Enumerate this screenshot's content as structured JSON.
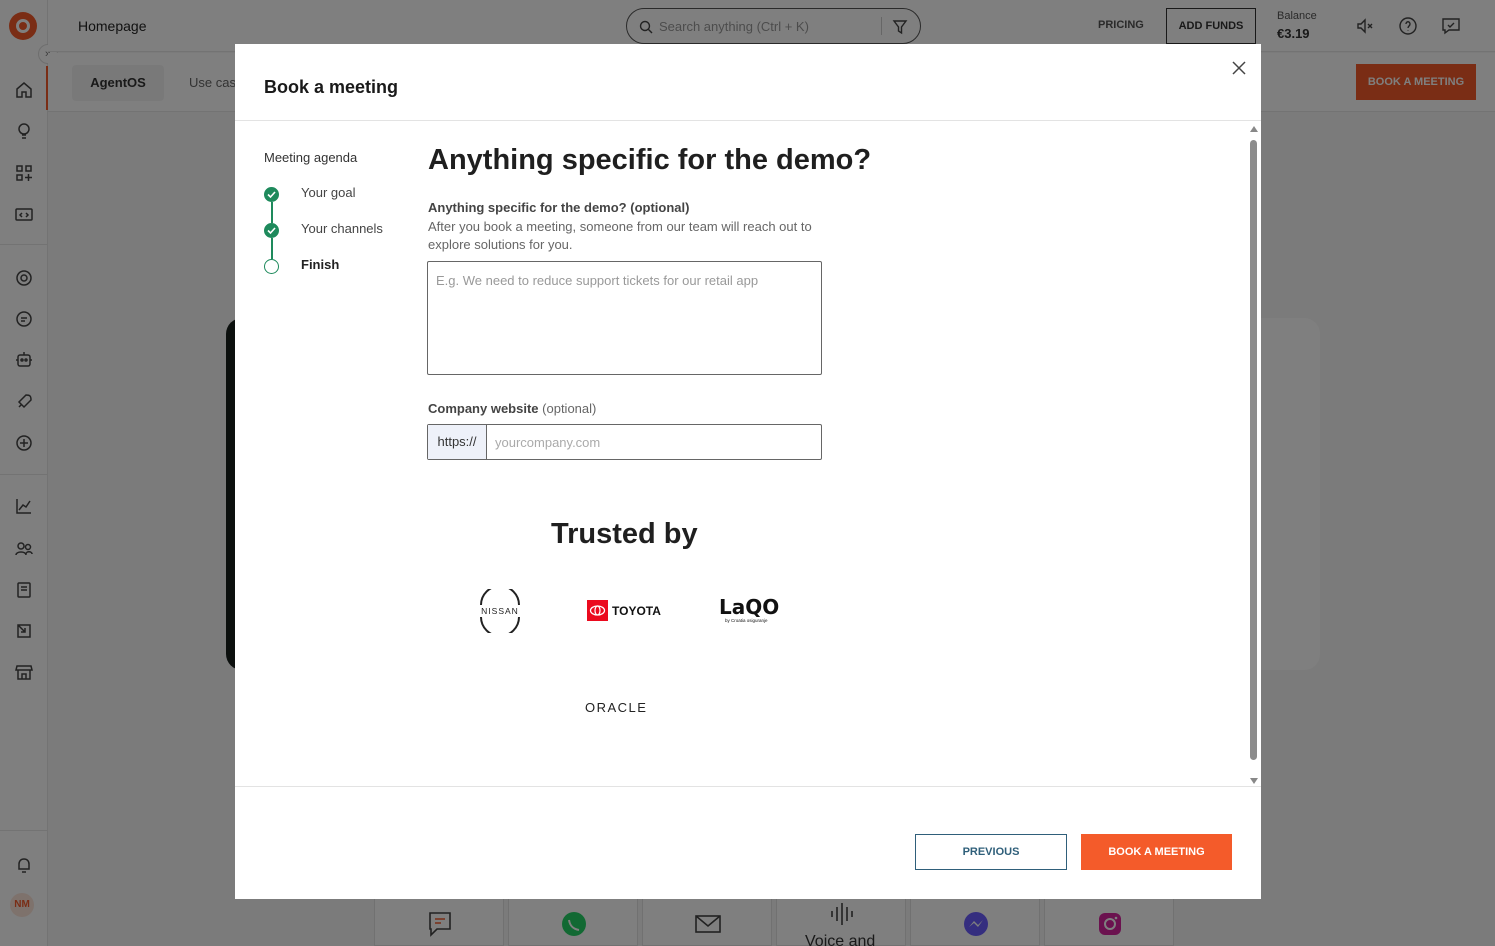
{
  "app": {
    "page_title": "Homepage",
    "search_placeholder": "Search anything (Ctrl + K)",
    "pricing_label": "PRICING",
    "add_funds_label": "ADD FUNDS",
    "balance_label": "Balance",
    "balance_value": "€3.19",
    "user_initials": "NM",
    "subnav": {
      "active_tab": "AgentOS",
      "next_tab": "Use cas"
    },
    "book_meeting_label": "BOOK A MEETING",
    "channels": [
      {
        "icon": "chat-icon"
      },
      {
        "icon": "whatsapp-icon"
      },
      {
        "icon": "email-icon"
      },
      {
        "icon": "voice-icon",
        "label": "Voice and"
      },
      {
        "icon": "messenger-icon"
      },
      {
        "icon": "instagram-icon"
      }
    ]
  },
  "modal": {
    "title": "Book a meeting",
    "agenda": {
      "title": "Meeting agenda",
      "steps": [
        {
          "label": "Your goal",
          "status": "done"
        },
        {
          "label": "Your channels",
          "status": "done"
        },
        {
          "label": "Finish",
          "status": "current"
        }
      ]
    },
    "heading": "Anything specific for the demo?",
    "demo_field": {
      "label": "Anything specific for the demo? (optional)",
      "help": "After you book a meeting, someone from our team will reach out to explore solutions for you.",
      "placeholder": "E.g. We need to reduce support tickets for our retail app",
      "value": ""
    },
    "website_field": {
      "label": "Company website",
      "optional": "(optional)",
      "prefix": "https://",
      "placeholder": "yourcompany.com",
      "value": ""
    },
    "trusted_title": "Trusted by",
    "brands": {
      "nissan": "NISSAN",
      "toyota": "TOYOTA",
      "laqo": "LaQO",
      "laqo_sub": "by Croatia osiguranje",
      "oracle": "ORACLE"
    },
    "previous_label": "PREVIOUS",
    "book_label": "BOOK A MEETING"
  },
  "colors": {
    "accent": "#f45b2a",
    "step_green": "#1e8a5c",
    "prev_border": "#2f5f7a",
    "toyota_red": "#eb0a1e"
  }
}
